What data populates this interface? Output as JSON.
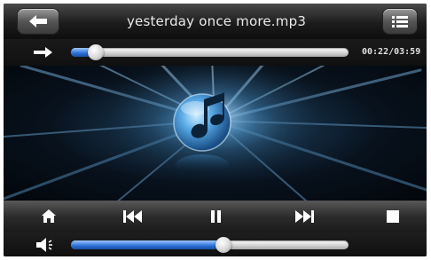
{
  "header": {
    "title": "yesterday once more.mp3",
    "back_icon": "arrow-left-icon",
    "playlist_icon": "list-icon"
  },
  "progress": {
    "icon": "arrow-right-icon",
    "time_text": "00:22/03:59",
    "fraction": 0.09
  },
  "artwork": {
    "icon": "music-note-icon"
  },
  "controls": {
    "home_icon": "home-icon",
    "prev_icon": "skip-previous-icon",
    "pause_icon": "pause-icon",
    "next_icon": "skip-next-icon",
    "stop_icon": "stop-icon"
  },
  "volume": {
    "icon": "speaker-icon",
    "fraction": 0.55
  },
  "colors": {
    "accent": "#2a6fd6",
    "background": "#141414"
  }
}
